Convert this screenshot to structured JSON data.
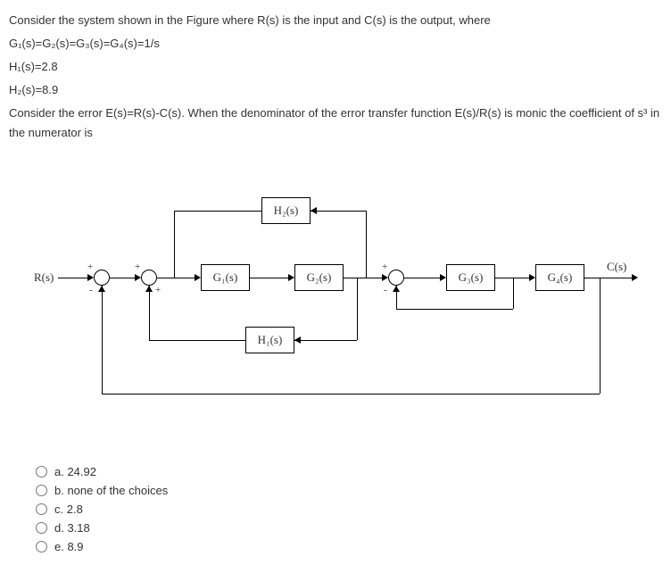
{
  "question": {
    "line1": "Consider the system shown in the Figure where R(s) is the input and C(s) is the output, where",
    "line2": "G₁(s)=G₂(s)=G₃(s)=G₄(s)=1/s",
    "line3": "H₁(s)=2.8",
    "line4": "H₂(s)=8.9",
    "line5": "Consider the error E(s)=R(s)-C(s).  When the denominator of the error transfer function E(s)/R(s) is monic the coefficient of s³ in the numerator is"
  },
  "diagram": {
    "input_label": "R(s)",
    "output_label": "C(s)",
    "g1": "G₁(s)",
    "g2": "G₂(s)",
    "g3": "G₃(s)",
    "g4": "G₄(s)",
    "h1": "H₁(s)",
    "h2": "H₂(s)"
  },
  "options": {
    "a": "a. 24.92",
    "b": "b. none of the choices",
    "c": "c. 2.8",
    "d": "d. 3.18",
    "e": "e. 8.9"
  }
}
